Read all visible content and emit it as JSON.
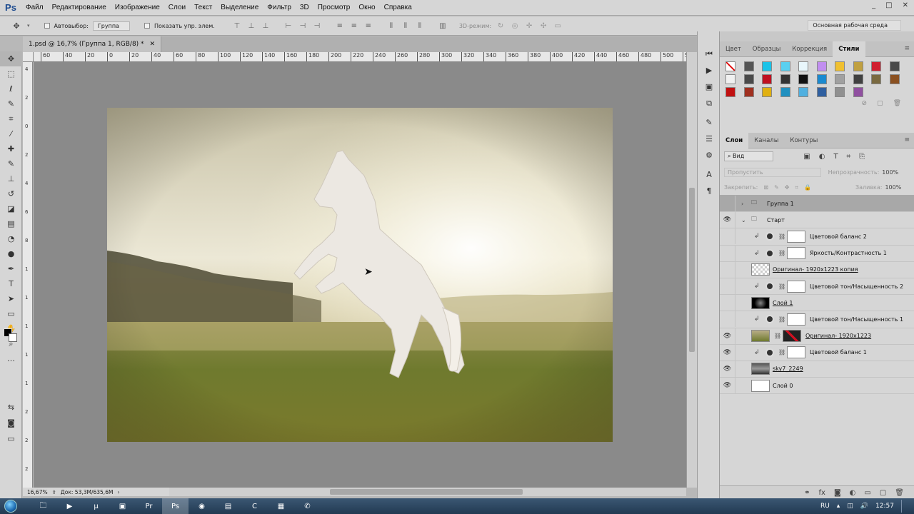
{
  "app": {
    "logo": "Ps",
    "title_controls": [
      "_",
      "□",
      "✕"
    ]
  },
  "menu": [
    "Файл",
    "Редактирование",
    "Изображение",
    "Слои",
    "Текст",
    "Выделение",
    "Фильтр",
    "3D",
    "Просмотр",
    "Окно",
    "Справка"
  ],
  "options": {
    "autoselect_label": "Автовыбор:",
    "autoselect_value": "Группа",
    "show_controls_label": "Показать упр. элем.",
    "mode3d_label": "3D-режим:",
    "workspace": "Основная рабочая среда"
  },
  "document": {
    "tab_title": "1.psd @ 16,7% (Группа 1, RGB/8) *",
    "zoom": "16,67%",
    "doc_size": "Док: 53,3M/635,6M"
  },
  "ruler_h": [
    "60",
    "40",
    "20",
    "0",
    "20",
    "40",
    "60",
    "80",
    "100",
    "120",
    "140",
    "160",
    "180",
    "200",
    "220",
    "240",
    "260",
    "280",
    "300",
    "320",
    "340",
    "360",
    "380",
    "400",
    "420",
    "440",
    "460",
    "480",
    "500",
    "520"
  ],
  "ruler_v": [
    "4",
    "2",
    "0",
    "2",
    "4",
    "6",
    "8",
    "1",
    "1",
    "1",
    "1",
    "1",
    "2",
    "2",
    "2"
  ],
  "tools": [
    "move-tool",
    "marquee-tool",
    "lasso-tool",
    "quick-select-tool",
    "crop-tool",
    "eyedropper-tool",
    "healing-tool",
    "brush-tool",
    "stamp-tool",
    "history-brush-tool",
    "eraser-tool",
    "gradient-tool",
    "blur-tool",
    "dodge-tool",
    "pen-tool",
    "type-tool",
    "path-select-tool",
    "shape-tool",
    "hand-tool",
    "zoom-tool",
    "more-tools"
  ],
  "styles_panel": {
    "tabs": [
      "Цвет",
      "Образцы",
      "Коррекция",
      "Стили"
    ],
    "active_tab": "Стили",
    "swatch_colors": [
      "#ffffff",
      "#555555",
      "#19c3e8",
      "#5ad0f0",
      "#e8f6fb",
      "#c18ef0",
      "#f0c030",
      "#c0a040",
      "#d02030",
      "#4a4a4a",
      "#f0f0f0",
      "#4a4a4a",
      "#c01020",
      "#333333",
      "#111111",
      "#1a8ad0",
      "#a0a0a0",
      "#404040",
      "#7a6a40",
      "#8a5020",
      "#c01010",
      "#a03020",
      "#e0b010",
      "#2090c0",
      "#50b0e0",
      "#3060a0",
      "#909090",
      "#9050a0"
    ]
  },
  "layers_panel": {
    "tabs": [
      "Слои",
      "Каналы",
      "Контуры"
    ],
    "filter_value": "Вид",
    "blend_mode": "Пропустить",
    "opacity_label": "Непрозрачность:",
    "opacity_value": "100%",
    "lock_label": "Закрепить:",
    "fill_label": "Заливка:",
    "fill_value": "100%",
    "layers": [
      {
        "name": "Группа 1",
        "kind": "group",
        "visible": false,
        "selected": true,
        "indent": 0
      },
      {
        "name": "Старт",
        "kind": "group",
        "visible": true,
        "selected": false,
        "indent": 0
      },
      {
        "name": "Цветовой баланс 2",
        "kind": "adjust",
        "visible": false,
        "selected": false,
        "indent": 1
      },
      {
        "name": "Яркость/Контрастность 1",
        "kind": "adjust",
        "visible": false,
        "selected": false,
        "indent": 1
      },
      {
        "name": "Оригинал- 1920x1223 копия",
        "kind": "pixel",
        "visible": false,
        "selected": false,
        "indent": 1
      },
      {
        "name": "Цветовой тон/Насыщенность 2",
        "kind": "adjust",
        "visible": false,
        "selected": false,
        "indent": 1
      },
      {
        "name": "Слой 1",
        "kind": "pixel-dark",
        "visible": false,
        "selected": false,
        "indent": 1
      },
      {
        "name": "Цветовой тон/Насыщенность 1",
        "kind": "adjust",
        "visible": false,
        "selected": false,
        "indent": 1
      },
      {
        "name": "Оригинал- 1920x1223",
        "kind": "photo-mask",
        "visible": true,
        "selected": false,
        "indent": 1
      },
      {
        "name": "Цветовой баланс 1",
        "kind": "adjust",
        "visible": true,
        "selected": false,
        "indent": 1
      },
      {
        "name": "sky7_2249",
        "kind": "sky",
        "visible": true,
        "selected": false,
        "indent": 1
      },
      {
        "name": "Слой 0",
        "kind": "white",
        "visible": true,
        "selected": false,
        "indent": 1
      }
    ]
  },
  "taskbar": {
    "apps": [
      "explorer-app",
      "media-player-app",
      "utorrent-app",
      "terminal-app",
      "premiere-app",
      "photoshop-app",
      "chrome-app",
      "drive-app",
      "camtasia-app",
      "calculator-app",
      "viber-app"
    ],
    "lang": "RU",
    "time": "12:57"
  }
}
